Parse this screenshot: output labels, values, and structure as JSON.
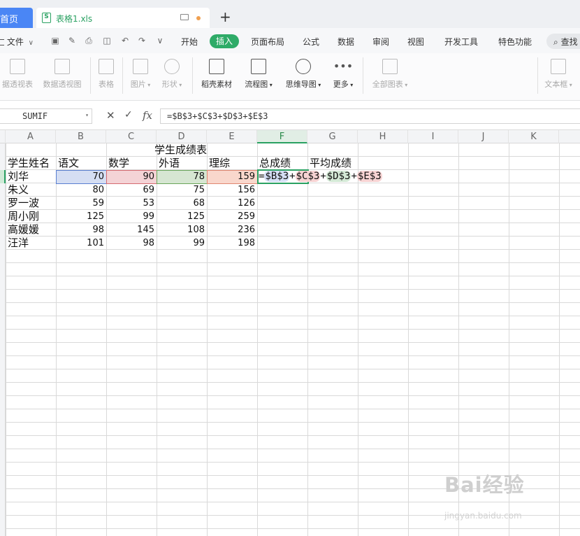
{
  "tabs": {
    "home": "首页",
    "file": "表格1.xls",
    "add": "+"
  },
  "menu": {
    "file": "文件",
    "items": [
      "开始",
      "插入",
      "页面布局",
      "公式",
      "数据",
      "审阅",
      "视图",
      "开发工具",
      "特色功能"
    ],
    "active": "插入",
    "search": "查找"
  },
  "ribbon": {
    "pivot_chart": "据透视表",
    "pivot_view": "数据透视图",
    "table": "表格",
    "picture": "图片",
    "shape": "形状",
    "material": "稻壳素材",
    "flowchart": "流程图",
    "mindmap": "思维导图",
    "more": "更多",
    "all_charts": "全部图表",
    "textbox": "文本框"
  },
  "formula_bar": {
    "name_box": "SUMIF",
    "fx": "fx",
    "formula": "=$B$3+$C$3+$D$3+$E$3"
  },
  "columns": [
    "A",
    "B",
    "C",
    "D",
    "E",
    "F",
    "G",
    "H",
    "I",
    "J",
    "K"
  ],
  "selected_column": "F",
  "sheet": {
    "title": "学生成绩表",
    "headers": [
      "学生姓名",
      "语文",
      "数学",
      "外语",
      "理综",
      "总成绩",
      "平均成绩"
    ],
    "rows": [
      {
        "name": "刘华",
        "values": [
          "70",
          "90",
          "78",
          "159"
        ]
      },
      {
        "name": "朱义",
        "values": [
          "80",
          "69",
          "75",
          "156"
        ]
      },
      {
        "name": "罗一波",
        "values": [
          "59",
          "53",
          "68",
          "126"
        ]
      },
      {
        "name": "周小刚",
        "values": [
          "125",
          "99",
          "125",
          "259"
        ]
      },
      {
        "name": "高媛媛",
        "values": [
          "98",
          "145",
          "108",
          "236"
        ]
      },
      {
        "name": "汪洋",
        "values": [
          "101",
          "98",
          "99",
          "198"
        ]
      }
    ],
    "editing_formula": {
      "eq": "=",
      "b": "$B$3",
      "c": "$C$3",
      "d": "$D$3",
      "e": "$E$3",
      "plus": "+"
    }
  },
  "watermark": {
    "brand": "Bai经验",
    "url": "jingyan.baidu.com"
  },
  "colors": {
    "accent": "#2aa162",
    "tab_blue": "#4a86f5"
  }
}
